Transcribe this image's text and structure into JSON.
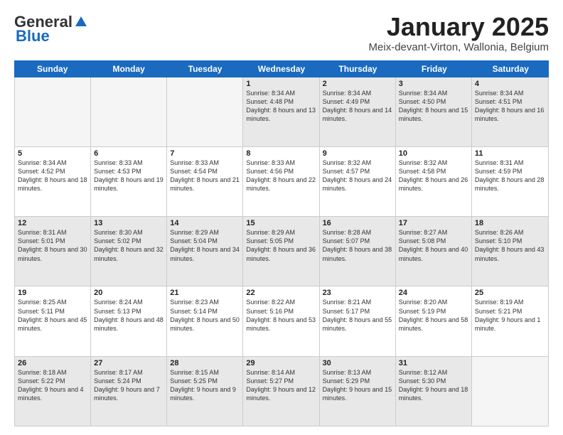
{
  "header": {
    "logo_general": "General",
    "logo_blue": "Blue",
    "month_title": "January 2025",
    "location": "Meix-devant-Virton, Wallonia, Belgium"
  },
  "days_of_week": [
    "Sunday",
    "Monday",
    "Tuesday",
    "Wednesday",
    "Thursday",
    "Friday",
    "Saturday"
  ],
  "weeks": [
    [
      {
        "day": "",
        "empty": true
      },
      {
        "day": "",
        "empty": true
      },
      {
        "day": "",
        "empty": true
      },
      {
        "day": "1",
        "sunrise": "8:34 AM",
        "sunset": "4:48 PM",
        "daylight": "8 hours and 13 minutes."
      },
      {
        "day": "2",
        "sunrise": "8:34 AM",
        "sunset": "4:49 PM",
        "daylight": "8 hours and 14 minutes."
      },
      {
        "day": "3",
        "sunrise": "8:34 AM",
        "sunset": "4:50 PM",
        "daylight": "8 hours and 15 minutes."
      },
      {
        "day": "4",
        "sunrise": "8:34 AM",
        "sunset": "4:51 PM",
        "daylight": "8 hours and 16 minutes."
      }
    ],
    [
      {
        "day": "5",
        "sunrise": "8:34 AM",
        "sunset": "4:52 PM",
        "daylight": "8 hours and 18 minutes."
      },
      {
        "day": "6",
        "sunrise": "8:33 AM",
        "sunset": "4:53 PM",
        "daylight": "8 hours and 19 minutes."
      },
      {
        "day": "7",
        "sunrise": "8:33 AM",
        "sunset": "4:54 PM",
        "daylight": "8 hours and 21 minutes."
      },
      {
        "day": "8",
        "sunrise": "8:33 AM",
        "sunset": "4:56 PM",
        "daylight": "8 hours and 22 minutes."
      },
      {
        "day": "9",
        "sunrise": "8:32 AM",
        "sunset": "4:57 PM",
        "daylight": "8 hours and 24 minutes."
      },
      {
        "day": "10",
        "sunrise": "8:32 AM",
        "sunset": "4:58 PM",
        "daylight": "8 hours and 26 minutes."
      },
      {
        "day": "11",
        "sunrise": "8:31 AM",
        "sunset": "4:59 PM",
        "daylight": "8 hours and 28 minutes."
      }
    ],
    [
      {
        "day": "12",
        "sunrise": "8:31 AM",
        "sunset": "5:01 PM",
        "daylight": "8 hours and 30 minutes."
      },
      {
        "day": "13",
        "sunrise": "8:30 AM",
        "sunset": "5:02 PM",
        "daylight": "8 hours and 32 minutes."
      },
      {
        "day": "14",
        "sunrise": "8:29 AM",
        "sunset": "5:04 PM",
        "daylight": "8 hours and 34 minutes."
      },
      {
        "day": "15",
        "sunrise": "8:29 AM",
        "sunset": "5:05 PM",
        "daylight": "8 hours and 36 minutes."
      },
      {
        "day": "16",
        "sunrise": "8:28 AM",
        "sunset": "5:07 PM",
        "daylight": "8 hours and 38 minutes."
      },
      {
        "day": "17",
        "sunrise": "8:27 AM",
        "sunset": "5:08 PM",
        "daylight": "8 hours and 40 minutes."
      },
      {
        "day": "18",
        "sunrise": "8:26 AM",
        "sunset": "5:10 PM",
        "daylight": "8 hours and 43 minutes."
      }
    ],
    [
      {
        "day": "19",
        "sunrise": "8:25 AM",
        "sunset": "5:11 PM",
        "daylight": "8 hours and 45 minutes."
      },
      {
        "day": "20",
        "sunrise": "8:24 AM",
        "sunset": "5:13 PM",
        "daylight": "8 hours and 48 minutes."
      },
      {
        "day": "21",
        "sunrise": "8:23 AM",
        "sunset": "5:14 PM",
        "daylight": "8 hours and 50 minutes."
      },
      {
        "day": "22",
        "sunrise": "8:22 AM",
        "sunset": "5:16 PM",
        "daylight": "8 hours and 53 minutes."
      },
      {
        "day": "23",
        "sunrise": "8:21 AM",
        "sunset": "5:17 PM",
        "daylight": "8 hours and 55 minutes."
      },
      {
        "day": "24",
        "sunrise": "8:20 AM",
        "sunset": "5:19 PM",
        "daylight": "8 hours and 58 minutes."
      },
      {
        "day": "25",
        "sunrise": "8:19 AM",
        "sunset": "5:21 PM",
        "daylight": "9 hours and 1 minute."
      }
    ],
    [
      {
        "day": "26",
        "sunrise": "8:18 AM",
        "sunset": "5:22 PM",
        "daylight": "9 hours and 4 minutes."
      },
      {
        "day": "27",
        "sunrise": "8:17 AM",
        "sunset": "5:24 PM",
        "daylight": "9 hours and 7 minutes."
      },
      {
        "day": "28",
        "sunrise": "8:15 AM",
        "sunset": "5:25 PM",
        "daylight": "9 hours and 9 minutes."
      },
      {
        "day": "29",
        "sunrise": "8:14 AM",
        "sunset": "5:27 PM",
        "daylight": "9 hours and 12 minutes."
      },
      {
        "day": "30",
        "sunrise": "8:13 AM",
        "sunset": "5:29 PM",
        "daylight": "9 hours and 15 minutes."
      },
      {
        "day": "31",
        "sunrise": "8:12 AM",
        "sunset": "5:30 PM",
        "daylight": "9 hours and 18 minutes."
      },
      {
        "day": "",
        "empty": true
      }
    ]
  ],
  "shaded_rows": [
    0,
    2,
    4
  ]
}
